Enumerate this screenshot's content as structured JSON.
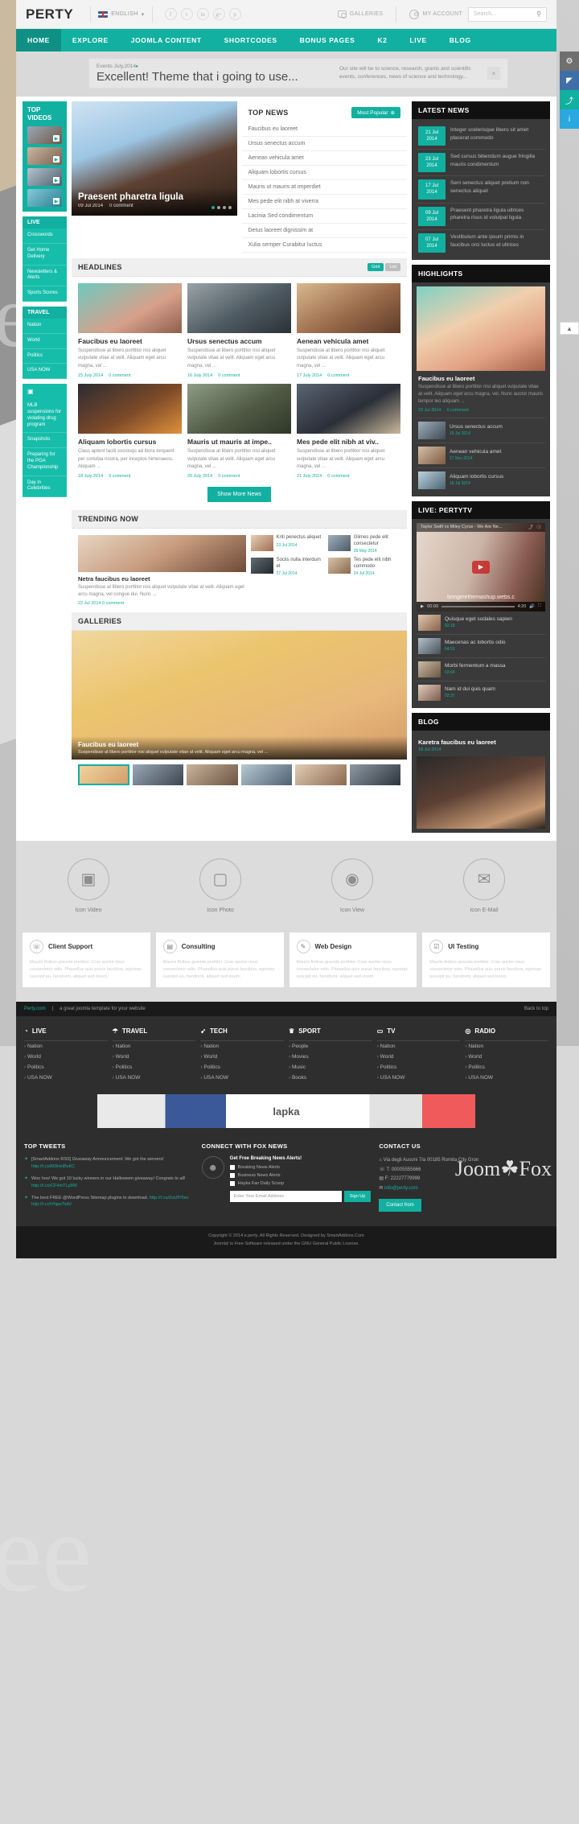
{
  "header": {
    "logo": "PERTY",
    "language": "ENGLISH",
    "socials": [
      "facebook-icon",
      "twitter-icon",
      "linkedin-icon",
      "googleplus-icon",
      "pinterest-icon"
    ],
    "social_glyphs": [
      "f",
      "t",
      "in",
      "g+",
      "p"
    ],
    "galleries": "GALLERIES",
    "my_account": "MY ACCOUNT",
    "search_placeholder": "Search...",
    "search_value": ""
  },
  "nav": {
    "items": [
      {
        "label": "HOME",
        "active": true
      },
      {
        "label": "EXPLORE",
        "active": false
      },
      {
        "label": "JOOMLA CONTENT",
        "active": false
      },
      {
        "label": "SHORTCODES",
        "active": false
      },
      {
        "label": "BONUS PAGES",
        "active": false
      },
      {
        "label": "K2",
        "active": false
      },
      {
        "label": "LIVE",
        "active": false
      },
      {
        "label": "BLOG",
        "active": false
      }
    ]
  },
  "ticker": {
    "label": "Events July,2014",
    "title": "Excellent! Theme that i going to use...",
    "desc": "Our site will be to science, research, grants and scientific events, conferences, news of science and technology...",
    "close": "×"
  },
  "left_rail": {
    "top_videos_title": "TOP VIDEOS",
    "sections": [
      {
        "title": "LIVE",
        "items": [
          "Crosswords",
          "Get Home Delivery",
          "Newsletters & Alerts",
          "Sports Scores"
        ]
      },
      {
        "title": "TRAVEL",
        "items": [
          "Nation",
          "World",
          "Politics",
          "USA NOW"
        ]
      },
      {
        "title": "",
        "items": [
          "MLB suspensions for violating drug program",
          "Snapshots",
          "Preparing for the PGA Championship",
          "Day in Celebrities"
        ]
      }
    ]
  },
  "featured": {
    "title": "Praesent pharetra ligula",
    "date": "09 Jul 2014",
    "comments": "0 comment"
  },
  "top_news": {
    "title": "TOP NEWS",
    "button": "Most Popular",
    "items": [
      "Faucibus eu laoreet",
      "Ursus senectus accum",
      "Aenean vehicula amet",
      "Aliquam lobortis cursus",
      "Mauris ut mauris at imperdiet",
      "Mes pede elit nibh at viverra",
      "Lacinia Sed condimentum",
      "Detus laoreet dignissim at",
      "Xulia semper Curabitur luctus"
    ]
  },
  "latest_news": {
    "title": "LATEST NEWS",
    "items": [
      {
        "date": "21 Jul",
        "year": "2014",
        "text": "Integer scelerisque libero sit amet placerat commodo"
      },
      {
        "date": "23 Jul",
        "year": "2014",
        "text": "Sed cursus bibendum augue fringilla mauris condimentum"
      },
      {
        "date": "17 Jul",
        "year": "2014",
        "text": "Seni senectus aliquet pretium non senectus aliquet"
      },
      {
        "date": "09 Jul",
        "year": "2014",
        "text": "Praesent pharetra ligula ultrices pharetra risus id volutpat ligula"
      },
      {
        "date": "07 Jul",
        "year": "2014",
        "text": "Vestibulum ante ipsum primis in faucibus orci luctus et ultrices"
      }
    ]
  },
  "headlines": {
    "title": "HEADLINES",
    "view_grid": "Grid",
    "view_list": "List",
    "show_more": "Show More News",
    "cards": [
      {
        "title": "Faucibus eu laoreet",
        "excerpt": "Suspendisse at libero porttitor nisi aliquet vulputate vitae at velit. Aliquam eget arcu magna, vel ...",
        "date": "15 July 2014",
        "comments": "0 comment"
      },
      {
        "title": "Ursus senectus accum",
        "excerpt": "Suspendisse at libero porttitor nisi aliquet vulputate vitae at velit. Aliquam eget arcu magna, vel ...",
        "date": "16 July 2014",
        "comments": "0 comment"
      },
      {
        "title": "Aenean vehicula amet",
        "excerpt": "Suspendisse at libero porttitor nisi aliquet vulputate vitae at velit. Aliquam eget arcu magna, vel ...",
        "date": "17 July 2014",
        "comments": "0 comment"
      },
      {
        "title": "Aliquam lobortis cursus",
        "excerpt": "Class aptent taciti sociosqu ad litora torquent per conubia nostra, per inceptos himenaeos. Aliquam ...",
        "date": "18 July 2014",
        "comments": "0 comment"
      },
      {
        "title": "Mauris ut mauris at impe..",
        "excerpt": "Suspendisse at libero porttitor nisi aliquet vulputate vitae at velit. Aliquam eget arcu magna, vel ...",
        "date": "20 July 2014",
        "comments": "0 comment"
      },
      {
        "title": "Mes pede elit nibh at viv..",
        "excerpt": "Suspendisse at libero porttitor nisi aliquet vulputate vitae at velit. Aliquam eget arcu magna, vel ...",
        "date": "21 July 2014",
        "comments": "0 comment"
      }
    ]
  },
  "highlights": {
    "title": "HIGHLIGHTS",
    "main": {
      "title": "Faucibus eu laoreet",
      "excerpt": "Suspendisse at libero porttitor nisi aliquet vulputate vitae at velit. Aliquam eget arcu magna, vel. Nunc auctor mauris tempor leo aliquam ...",
      "date": "23 Jul 2014",
      "comments": "0 comment"
    },
    "items": [
      {
        "title": "Ursus senectus accum",
        "date": "16 Jul 2014"
      },
      {
        "title": "Aenean vehicula amet",
        "date": "17 Nov 2014"
      },
      {
        "title": "Aliquam lobortis cursus",
        "date": "18 Jul 2014"
      }
    ]
  },
  "trending": {
    "title": "TRENDING NOW",
    "feature": {
      "title": "Netra faucibus eu laoreet",
      "excerpt": "Suspendisse at libero porttitor nisi aliquet vulputate vitae at velit. Aliquam eget arcu magna, vel congue dui. Nunc ...",
      "date": "22 Jul 2014",
      "comments": "0 comment"
    },
    "items": [
      {
        "title": "Kriti penectus aliquet",
        "date": "23 Jul 2014",
        "comments": "0 comment"
      },
      {
        "title": "Glimes pede elit consectetur",
        "date": "28 May 2014",
        "comments": ""
      },
      {
        "title": "Sociis nulla interdum et",
        "date": "27 Jul 2014",
        "comments": "0 comment"
      },
      {
        "title": "Tes pede elit nibh commodo",
        "date": "24 Jul 2014",
        "comments": "0 comment"
      }
    ]
  },
  "galleries": {
    "title": "GALLERIES",
    "main": {
      "title": "Faucibus eu laoreet",
      "excerpt": "Suspendisse at libero porttitor nisi aliquet vulputate vitae at velit. Aliquam eget arcu magna, vel ..."
    },
    "thumb_count": 6
  },
  "live_tv": {
    "title": "LIVE: PERTYTV",
    "player_title": "Taylor Swift vs Miley Cyrus - We Are Ne...",
    "overlay_text": "bringmethemashup.webs.c",
    "time_current": "00:00",
    "time_total": "4:20",
    "items": [
      {
        "title": "Quisque eget sodales sapien",
        "dur": "02:18"
      },
      {
        "title": "Maecenas ac lobortis odio",
        "dur": "04:51"
      },
      {
        "title": "Morbi fermentum a massa",
        "dur": "03:04"
      },
      {
        "title": "Nam id dui quis quam",
        "dur": "02:37"
      }
    ]
  },
  "blog": {
    "title": "BLOG",
    "post_title": "Karetra faucibus eu laoreet",
    "date": "18 Jul 2014"
  },
  "icon_strip": [
    {
      "icon": "video-icon",
      "glyph": "▣",
      "label": "Icon Video"
    },
    {
      "icon": "photo-icon",
      "glyph": "▢",
      "label": "Icon Photo"
    },
    {
      "icon": "eye-icon",
      "glyph": "◉",
      "label": "Icon View"
    },
    {
      "icon": "mail-icon",
      "glyph": "✉",
      "label": "Icon E-Mail"
    }
  ],
  "services": [
    {
      "icon": "headset-icon",
      "glyph": "☏",
      "title": "Client Support",
      "text": "Mauris finibus gravida porttitor. Cras auctor risus consectetur odio. Phasellus quis purus faucibus, egestas suscipit eu, hendrerit, aliquet sed lorem."
    },
    {
      "icon": "briefcase-icon",
      "glyph": "▤",
      "title": "Consulting",
      "text": "Mauris finibus gravida porttitor. Cras auctor risus consectetur odio. Phasellus quis purus faucibus, egestas suscipit eu, hendrerit, aliquet sed lorem."
    },
    {
      "icon": "brush-icon",
      "glyph": "✎",
      "title": "Web Design",
      "text": "Mauris finibus gravida porttitor. Cras auctor risus consectetur odio. Phasellus quis purus faucibus, egestas suscipit eu, hendrerit, aliquet sed lorem."
    },
    {
      "icon": "checklist-icon",
      "glyph": "☑",
      "title": "UI Testing",
      "text": "Mauris finibus gravida porttitor. Cras auctor risus consectetur odio. Phasellus quis purus faucibus, egestas suscipit eu, hendrerit, aliquet sed lorem."
    }
  ],
  "footer": {
    "brand": "Perty.com",
    "tagline": "a great joomla template for your website",
    "back_to_top": "Back to top",
    "columns": [
      {
        "icon": "live-icon",
        "glyph": "◔",
        "title": "LIVE",
        "links": [
          "Nation",
          "World",
          "Politics",
          "USA NOW"
        ]
      },
      {
        "icon": "umbrella-icon",
        "glyph": "☂",
        "title": "TRAVEL",
        "links": [
          "Nation",
          "World",
          "Politics",
          "USA NOW"
        ]
      },
      {
        "icon": "rocket-icon",
        "glyph": "➹",
        "title": "TECH",
        "links": [
          "Nation",
          "World",
          "Politics",
          "USA NOW"
        ]
      },
      {
        "icon": "trophy-icon",
        "glyph": "♛",
        "title": "SPORT",
        "links": [
          "People",
          "Movies",
          "Music",
          "Books"
        ]
      },
      {
        "icon": "tv-icon",
        "glyph": "▭",
        "title": "TV",
        "links": [
          "Nation",
          "World",
          "Politics",
          "USA NOW"
        ]
      },
      {
        "icon": "radio-icon",
        "glyph": "◎",
        "title": "RADIO",
        "links": [
          "Nation",
          "World",
          "Politics",
          "USA NOW"
        ]
      }
    ],
    "ad_text": "lapka",
    "tweets": {
      "title": "TOP TWEETS",
      "items": [
        {
          "text": "[SmartAddons RSS] Giveaway Announcement: We got the winners!",
          "link": "http://t.co/M3HxIBsKC"
        },
        {
          "text": "Woo hoo! We got 10 lucky winners in our Halloween giveaway! Congrats to all!",
          "link": "http://t.co/CF4mTLp9W"
        },
        {
          "text": "The best FREE @WordPress Sitemap plugins to download.",
          "link": "http://t.co/ZutJfY5ec http://t.co/VhjazTsdV"
        }
      ]
    },
    "connect": {
      "title": "CONNECT WITH FOX NEWS",
      "subtitle": "Get Free Breaking News Alerts!",
      "options": [
        "Breaking News Alerts",
        "Business News Alerts",
        "Hayka Fan Daily Scoop"
      ],
      "input_placeholder": "Enter Your Email Address",
      "button": "Sign Up"
    },
    "contact": {
      "title": "CONTACT US",
      "address": "Via degli Ausoni 7/a 00185 Romita City Gron",
      "phone": "T: 00005555666",
      "fax": "F: 22227779999",
      "email": "info@perty.com",
      "button": "Contact from"
    },
    "copyright_line1": "Copyright © 2014 e.perty. All Rights Reserved. Designed by SmartAddons.Com",
    "copyright_line2": "Joomla! is Free Software released under the GNU General Public License.",
    "watermark": "Joom☘Fox"
  },
  "side_tabs": [
    {
      "icon": "wrench-icon",
      "glyph": "⚙",
      "color": "#6f6f6f"
    },
    {
      "icon": "megaphone-icon",
      "glyph": "📣",
      "color": "#3f6fa8"
    },
    {
      "icon": "share-icon",
      "glyph": "⤴",
      "color": "#12b0a0"
    },
    {
      "icon": "info-icon",
      "glyph": "i",
      "color": "#2aa9e0"
    }
  ],
  "colors": {
    "accent": "#12b0a0",
    "dark": "#3a3a3a",
    "darker": "#111111"
  }
}
